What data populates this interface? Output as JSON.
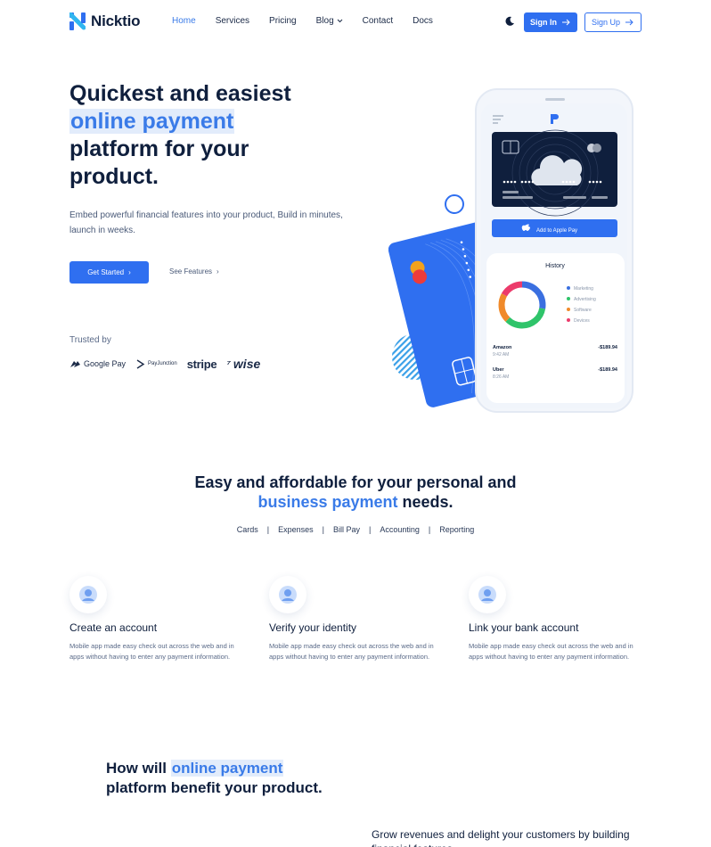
{
  "brand": {
    "name": "Nicktio"
  },
  "nav": {
    "links": [
      "Home",
      "Services",
      "Pricing",
      "Blog",
      "Contact",
      "Docs"
    ],
    "active": "Home",
    "signin_label": "Sign In",
    "signup_label": "Sign Up"
  },
  "hero": {
    "title_line1": "Quickest and easiest",
    "title_highlight": "online payment",
    "title_line3": "platform for your",
    "title_line4": "product.",
    "description": "Embed powerful financial features into your product, Build in minutes, launch in weeks.",
    "cta_primary": "Get Started",
    "cta_secondary": "See Features",
    "trusted_label": "Trusted by",
    "brands": [
      "Google Pay",
      "PayJunction",
      "stripe",
      "wise"
    ]
  },
  "phone": {
    "apple_pay_label": "Add to Apple Pay",
    "history_title": "History",
    "legend": [
      "Marketing",
      "Advertising",
      "Software",
      "Devices"
    ],
    "transactions": [
      {
        "name": "Amazon",
        "time": "9:42 AM",
        "amount": "-$189.94"
      },
      {
        "name": "Uber",
        "time": "8:26 AM",
        "amount": "-$189.94"
      }
    ]
  },
  "section2": {
    "title_line1": "Easy and affordable for your personal and",
    "title_highlight": "business payment",
    "title_end": " needs.",
    "tabs": [
      "Cards",
      "Expenses",
      "Bill Pay",
      "Accounting",
      "Reporting"
    ]
  },
  "features": [
    {
      "title": "Create an account",
      "desc": "Mobile app made easy check out across the web and in apps without having to enter any payment information."
    },
    {
      "title": "Verify your identity",
      "desc": "Mobile app made easy check out across the web and in apps without having to enter any payment information."
    },
    {
      "title": "Link your bank account",
      "desc": "Mobile app made easy check out across the web and in apps without having to enter any payment information."
    }
  ],
  "section3": {
    "title_pre": "How will ",
    "title_highlight": "online payment",
    "title_line2": "platform benefit your product.",
    "subtitle": "Grow revenues and delight your customers by building financial features"
  },
  "colors": {
    "accent": "#2f6ff0",
    "highlight_text": "#3a7be8",
    "highlight_bg": "#e2ecfb",
    "heading": "#0f1f3d",
    "legend": [
      "#3a6fe0",
      "#2fc46a",
      "#f08a2a",
      "#ec3b6b"
    ]
  }
}
